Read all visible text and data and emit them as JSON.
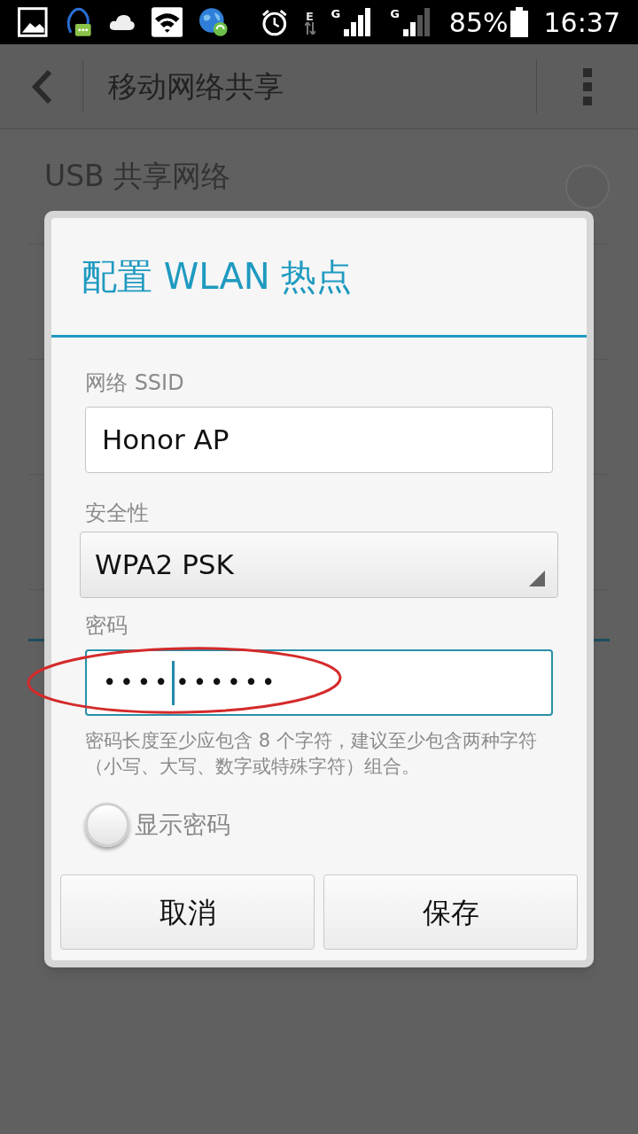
{
  "status_bar": {
    "battery": "85%",
    "time": "16:37",
    "network_labels": [
      "E",
      "G",
      "G"
    ]
  },
  "action_bar": {
    "title": "移动网络共享"
  },
  "background_list": [
    {
      "title": "USB 共享网络",
      "on": false
    }
  ],
  "dialog": {
    "title": "配置 WLAN 热点",
    "ssid": {
      "label": "网络 SSID",
      "value": "Honor AP"
    },
    "security": {
      "label": "安全性",
      "value": "WPA2 PSK"
    },
    "password": {
      "label": "密码",
      "value_before_cursor": "••••",
      "value_after_cursor": "••••••",
      "focused": true
    },
    "hint": "密码长度至少应包含 8 个字符，建议至少包含两种字符（小写、大写、数字或特殊字符）组合。",
    "show_password": {
      "label": "显示密码",
      "checked": false
    },
    "buttons": [
      "取消",
      "保存"
    ]
  }
}
